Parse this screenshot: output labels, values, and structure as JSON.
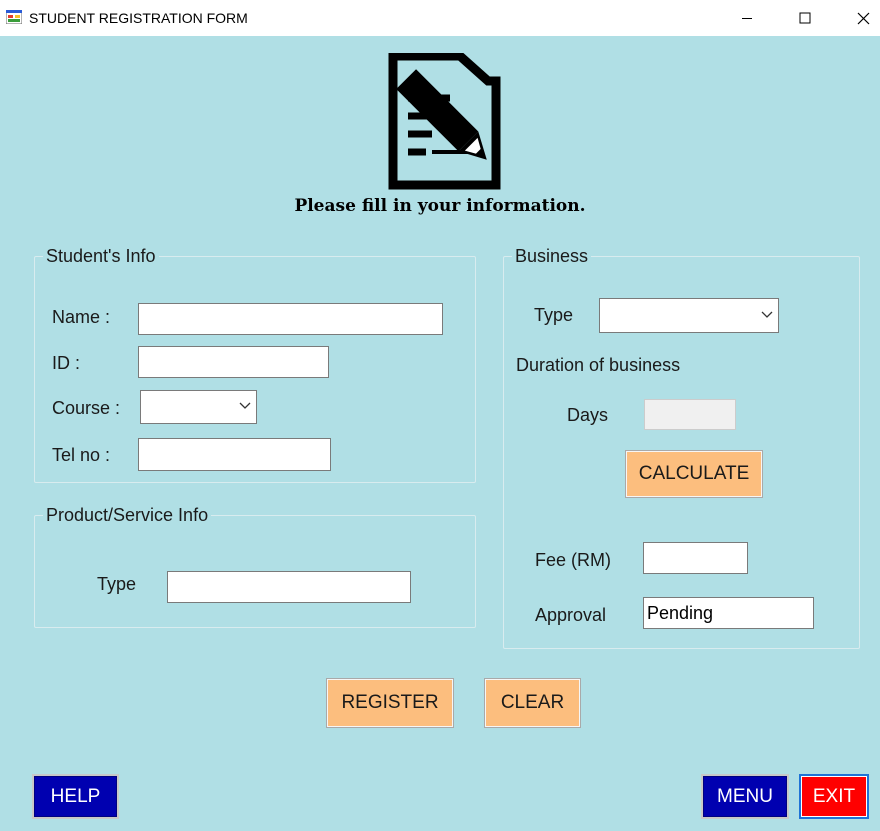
{
  "window": {
    "title": "STUDENT REGISTRATION FORM",
    "app_icon": "form-app-icon",
    "controls": {
      "minimize": "minimize-icon",
      "maximize": "maximize-icon",
      "close": "close-icon"
    }
  },
  "header": {
    "logo_icon": "document-pencil-icon",
    "subtitle": "Please fill in your information."
  },
  "student_info": {
    "legend": "Student's Info",
    "name_label": "Name :",
    "name_value": "",
    "id_label": "ID :",
    "id_value": "",
    "course_label": "Course :",
    "course_value": "",
    "tel_label": "Tel no :",
    "tel_value": ""
  },
  "product_info": {
    "legend": "Product/Service Info",
    "type_label": "Type",
    "type_value": ""
  },
  "business": {
    "legend": "Business",
    "type_label": "Type",
    "type_value": "",
    "duration_label": "Duration of business",
    "days_label": "Days",
    "days_value": "",
    "calculate_label": "CALCULATE",
    "fee_label": "Fee (RM)",
    "fee_value": "",
    "approval_label": "Approval",
    "approval_value": "Pending"
  },
  "actions": {
    "register_label": "REGISTER",
    "clear_label": "CLEAR",
    "help_label": "HELP",
    "menu_label": "MENU",
    "exit_label": "EXIT"
  },
  "colors": {
    "background": "#b0dfe5",
    "orange_button": "#fcbe7e",
    "blue_button": "#0000b0",
    "red_button": "#ff0000"
  }
}
